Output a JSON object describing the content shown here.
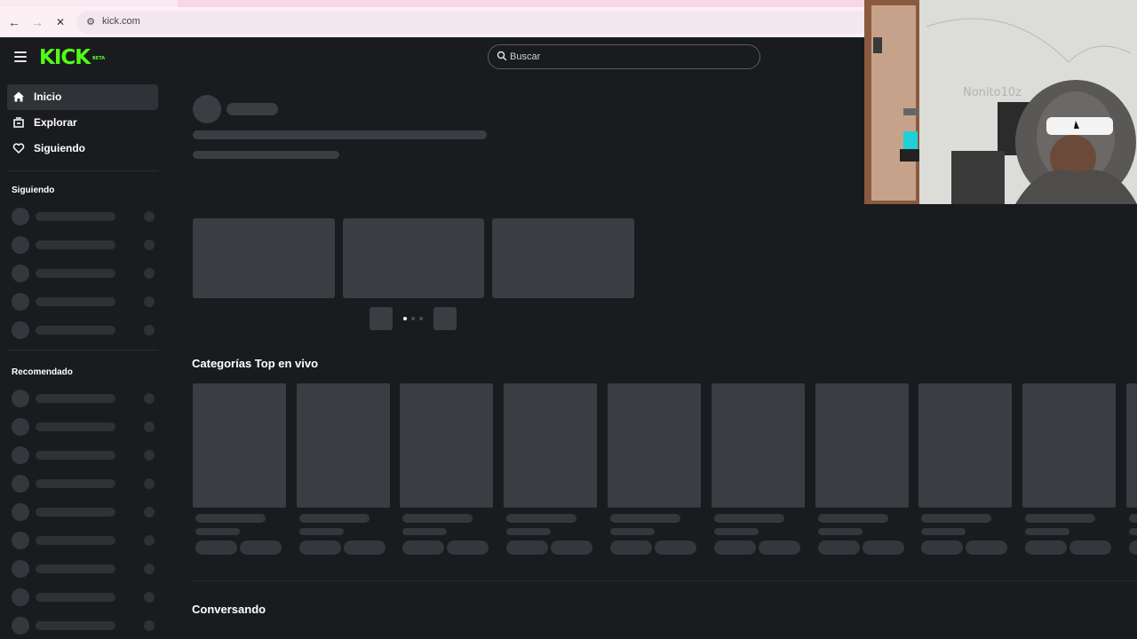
{
  "browser": {
    "url": "kick.com",
    "back_icon": "←",
    "forward_icon": "→",
    "stop_icon": "✕",
    "site_info_icon": "⚙"
  },
  "header": {
    "logo_text": "KICK",
    "logo_badge": "BETA",
    "search_placeholder": "Buscar"
  },
  "sidebar": {
    "items": [
      {
        "label": "Inicio",
        "icon": "home-icon",
        "active": true
      },
      {
        "label": "Explorar",
        "icon": "compass-icon",
        "active": false
      },
      {
        "label": "Siguiendo",
        "icon": "heart-icon",
        "active": false
      }
    ],
    "following_heading": "Siguiendo",
    "recommended_heading": "Recomendado"
  },
  "main": {
    "top_categories_title": "Categorías Top en vivo",
    "conversing_title": "Conversando"
  },
  "webcam": {
    "overlay_text": "Nonito10z"
  },
  "colors": {
    "brand": "#53fc18",
    "background": "#191b1f",
    "skeleton": "#3a3d42"
  }
}
